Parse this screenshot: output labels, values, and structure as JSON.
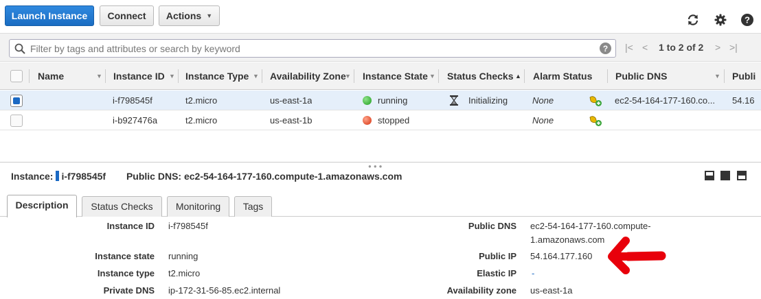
{
  "toolbar": {
    "launch_label": "Launch Instance",
    "connect_label": "Connect",
    "actions_label": "Actions"
  },
  "filter": {
    "placeholder": "Filter by tags and attributes or search by keyword",
    "pager_text": "1 to 2 of 2"
  },
  "table": {
    "columns": [
      "Name",
      "Instance ID",
      "Instance Type",
      "Availability Zone",
      "Instance State",
      "Status Checks",
      "Alarm Status",
      "Public DNS",
      "Publi"
    ],
    "rows": [
      {
        "selected": true,
        "name": "",
        "instance_id": "i-f798545f",
        "instance_type": "t2.micro",
        "zone": "us-east-1a",
        "state": "running",
        "state_color": "#1f9d1f",
        "status_checks": "Initializing",
        "alarm_status": "None",
        "public_dns": "ec2-54-164-177-160.co...",
        "public_ip": "54.16"
      },
      {
        "selected": false,
        "name": "",
        "instance_id": "i-b927476a",
        "instance_type": "t2.micro",
        "zone": "us-east-1b",
        "state": "stopped",
        "state_color": "#d5320f",
        "status_checks": "",
        "alarm_status": "None",
        "public_dns": "",
        "public_ip": ""
      }
    ]
  },
  "details": {
    "instance_label": "Instance:",
    "instance_id": "i-f798545f",
    "public_dns_label": "Public DNS:",
    "public_dns": "ec2-54-164-177-160.compute-1.amazonaws.com",
    "tabs": [
      "Description",
      "Status Checks",
      "Monitoring",
      "Tags"
    ],
    "left_fields": [
      {
        "label": "Instance ID",
        "value": "i-f798545f"
      },
      {
        "label": "Instance state",
        "value": "running"
      },
      {
        "label": "Instance type",
        "value": "t2.micro"
      },
      {
        "label": "Private DNS",
        "value": "ip-172-31-56-85.ec2.internal"
      }
    ],
    "right_fields": [
      {
        "label": "Public DNS",
        "value_line1": "ec2-54-164-177-160.compute-",
        "value_line2": "1.amazonaws.com"
      },
      {
        "label": "Public IP",
        "value": "54.164.177.160"
      },
      {
        "label": "Elastic IP",
        "value": "-"
      },
      {
        "label": "Availability zone",
        "value": "us-east-1a"
      }
    ]
  },
  "colors": {
    "primary": "#1a6dc2",
    "link": "#1a69c4",
    "annotation_arrow": "#e8000b"
  }
}
